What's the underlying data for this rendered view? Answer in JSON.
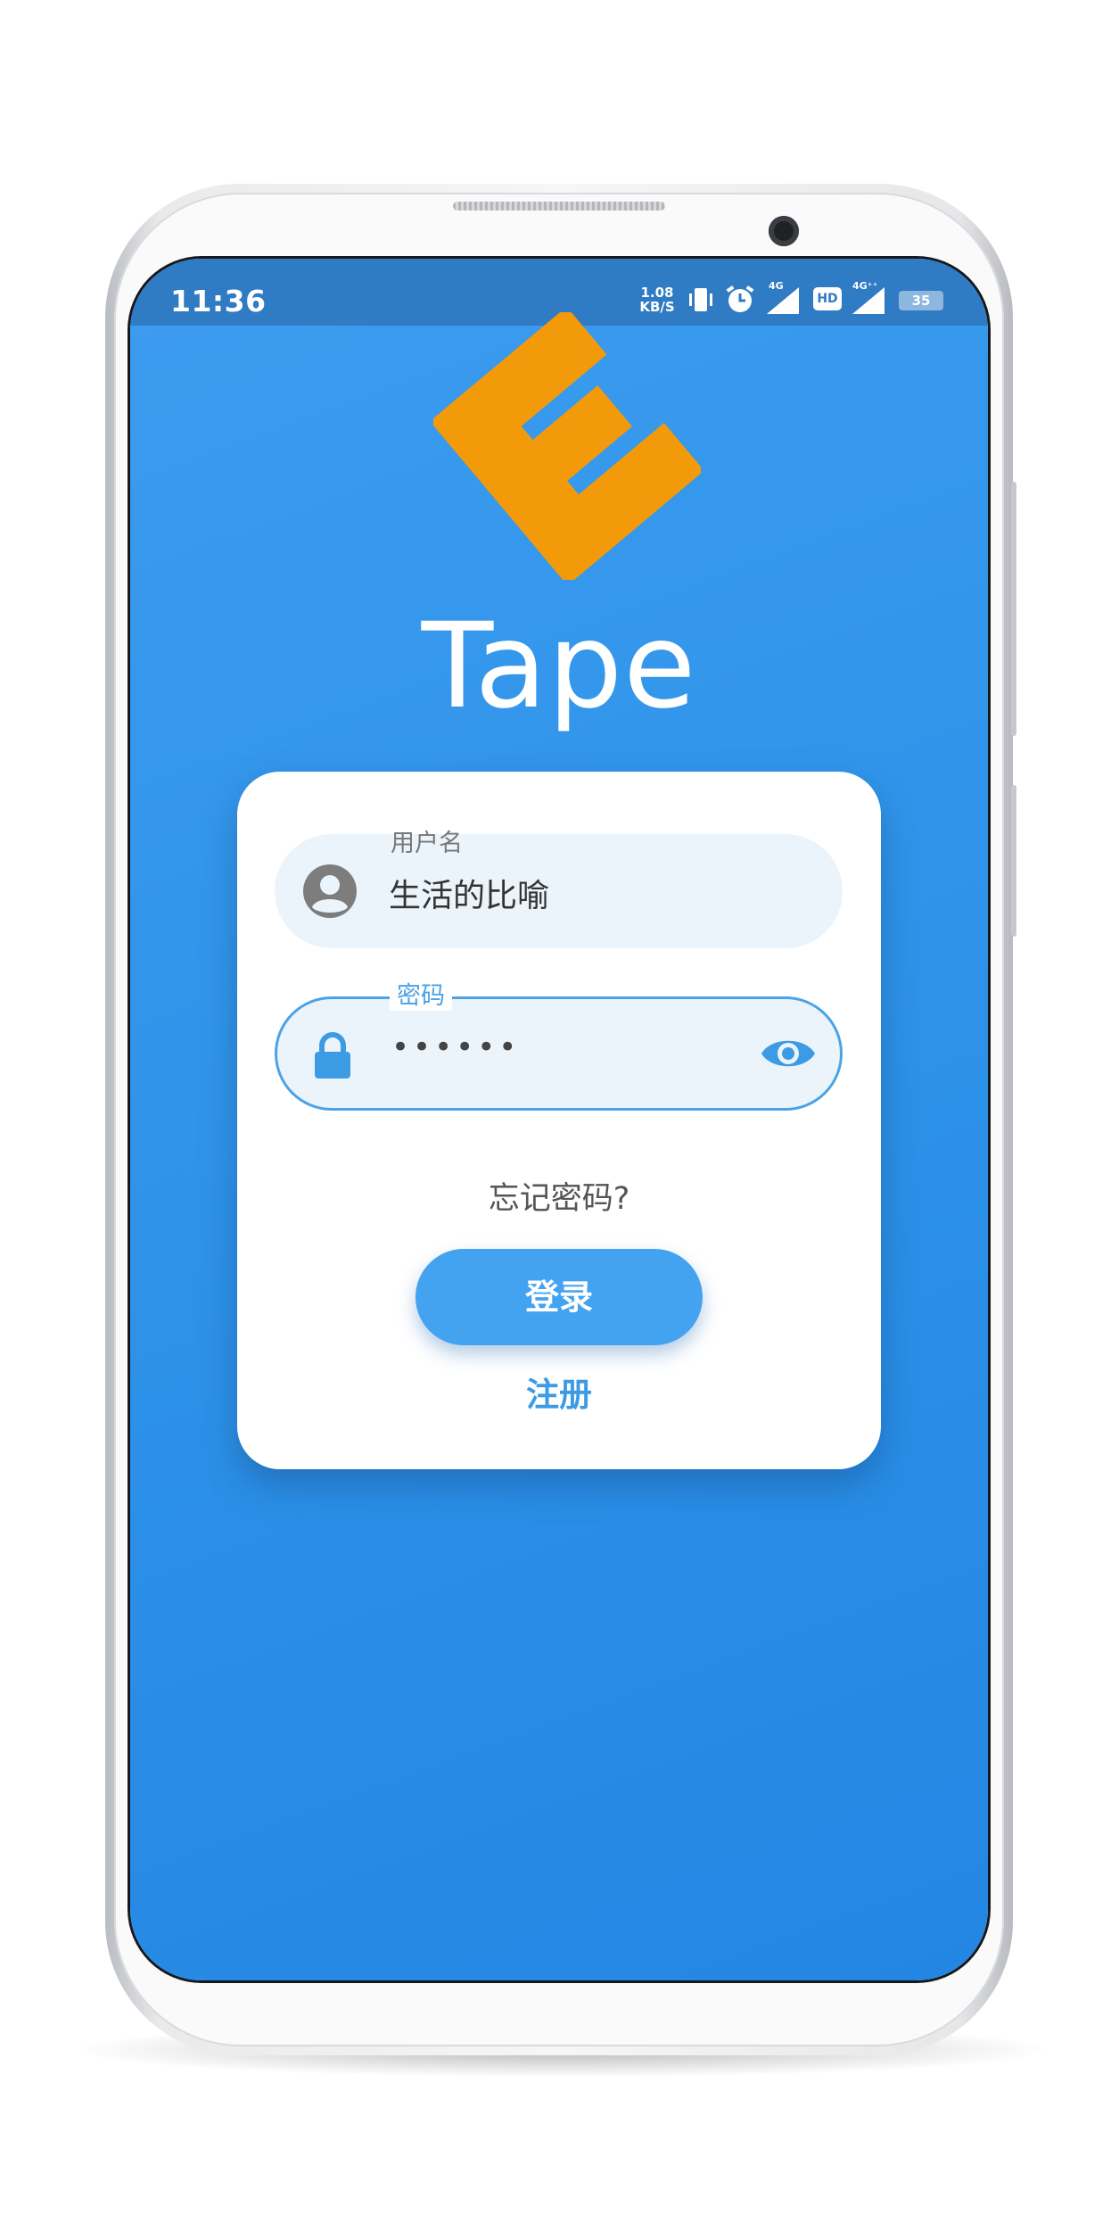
{
  "status_bar": {
    "time": "11:36",
    "network_speed": "1.08",
    "network_speed_unit": "KB/S",
    "signal_1": "4G",
    "hd_badge": "HD",
    "signal_2": "4G⁺⁺",
    "battery_level": "35"
  },
  "app": {
    "title": "Tape",
    "logo_letter": "E",
    "logo_color": "#f39a0a",
    "accent_color": "#44a3f1"
  },
  "login": {
    "username_label": "用户名",
    "username_value": "生活的比喻",
    "password_label": "密码",
    "password_value": "••••••",
    "forgot_password": "忘记密码?",
    "login_button": "登录",
    "register_link": "注册"
  }
}
